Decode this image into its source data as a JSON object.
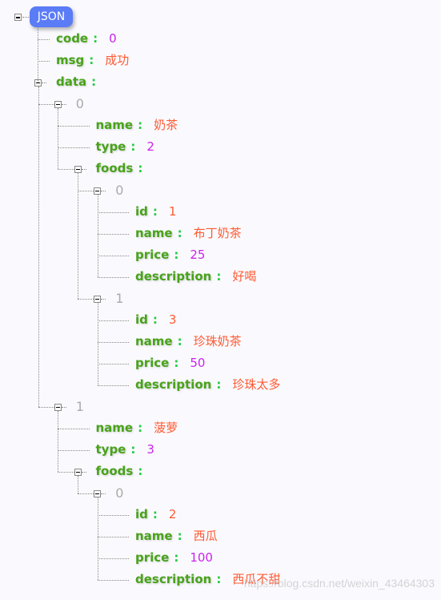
{
  "root_label": "JSON",
  "watermark": "https://blog.csdn.net/weixin_43464303",
  "colors": {
    "key": "#48a319",
    "colon": "#22cc44",
    "number": "#cc22ee",
    "string": "#ff5a33",
    "index": "#aaaaaa",
    "badge": "#5b7cf7"
  },
  "tree": [
    {
      "key": "code",
      "value": "0",
      "type": "number"
    },
    {
      "key": "msg",
      "value": "成功",
      "type": "string"
    },
    {
      "key": "data",
      "children": [
        {
          "index": "0",
          "children": [
            {
              "key": "name",
              "value": "奶茶",
              "type": "string"
            },
            {
              "key": "type",
              "value": "2",
              "type": "number"
            },
            {
              "key": "foods",
              "children": [
                {
                  "index": "0",
                  "children": [
                    {
                      "key": "id",
                      "value": "1",
                      "type": "string"
                    },
                    {
                      "key": "name",
                      "value": "布丁奶茶",
                      "type": "string"
                    },
                    {
                      "key": "price",
                      "value": "25",
                      "type": "number"
                    },
                    {
                      "key": "description",
                      "value": "好喝",
                      "type": "string"
                    }
                  ]
                },
                {
                  "index": "1",
                  "children": [
                    {
                      "key": "id",
                      "value": "3",
                      "type": "string"
                    },
                    {
                      "key": "name",
                      "value": "珍珠奶茶",
                      "type": "string"
                    },
                    {
                      "key": "price",
                      "value": "50",
                      "type": "number"
                    },
                    {
                      "key": "description",
                      "value": "珍珠太多",
                      "type": "string"
                    }
                  ]
                }
              ]
            }
          ]
        },
        {
          "index": "1",
          "children": [
            {
              "key": "name",
              "value": "菠萝",
              "type": "string"
            },
            {
              "key": "type",
              "value": "3",
              "type": "number"
            },
            {
              "key": "foods",
              "children": [
                {
                  "index": "0",
                  "children": [
                    {
                      "key": "id",
                      "value": "2",
                      "type": "string"
                    },
                    {
                      "key": "name",
                      "value": "西瓜",
                      "type": "string"
                    },
                    {
                      "key": "price",
                      "value": "100",
                      "type": "number"
                    },
                    {
                      "key": "description",
                      "value": "西瓜不甜",
                      "type": "string"
                    }
                  ]
                }
              ]
            }
          ]
        }
      ]
    }
  ]
}
